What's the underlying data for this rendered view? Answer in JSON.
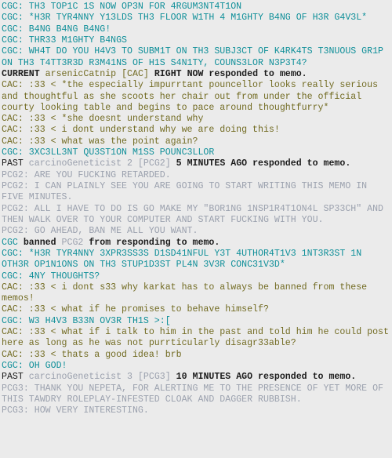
{
  "app": {
    "name": "pesterchum-memo",
    "window_title": "Memo Log"
  },
  "palette": {
    "background": "#ebebeb",
    "cgc_teal": "#0f8f99",
    "cac_olive": "#726b22",
    "pcg_grey_blue": "#9ba1ae",
    "system_black": "#1c1c1c"
  },
  "handles": [
    {
      "id": "CGC",
      "color_key": "cgc_teal"
    },
    {
      "id": "CAC",
      "color_key": "cac_olive",
      "full_name": "arsenicCatnip"
    },
    {
      "id": "PCG2",
      "color_key": "pcg_grey_blue",
      "full_name": "carcinoGeneticist 2"
    },
    {
      "id": "PCG3",
      "color_key": "pcg_grey_blue",
      "full_name": "carcinoGeneticist 3"
    }
  ],
  "log": [
    {
      "kind": "msg",
      "style": "c-cgc",
      "text": "CGC: TH3 TOP1C 1S NOW OP3N FOR 4RGUM3NT4T1ON"
    },
    {
      "kind": "msg",
      "style": "c-cgc",
      "text": "CGC: *H3R TYR4NNY Y13LDS TH3 FLOOR W1TH 4 M1GHTY B4NG OF H3R G4V3L*"
    },
    {
      "kind": "msg",
      "style": "c-cgc",
      "text": "CGC: B4NG B4NG B4NG!"
    },
    {
      "kind": "msg",
      "style": "c-cgc",
      "text": "CGC: THR33 M1GHTY B4NGS"
    },
    {
      "kind": "msg",
      "style": "c-cgc",
      "text": "CGC: WH4T DO YOU H4V3 TO SUBM1T ON TH3 SUBJ3CT OF K4RK4TS T3NUOUS GR1P ON TH3 T4TT3R3D R3M41NS OF H1S S4N1TY, COUNS3LOR N3P3T4?"
    },
    {
      "kind": "system",
      "segments": [
        {
          "text": "CURRENT ",
          "style": "c-sys"
        },
        {
          "text": "arsenicCatnip [CAC]",
          "style": "c-cac"
        },
        {
          "text": " RIGHT NOW responded to memo.",
          "style": "c-sys"
        }
      ]
    },
    {
      "kind": "msg",
      "style": "c-cac",
      "text": "CAC: :33 < *the especially impurrtant pouncellor looks really serious and thoughtful as she scoots her chair out from under the official courty looking table and begins to pace around thoughtfurry*"
    },
    {
      "kind": "msg",
      "style": "c-cac",
      "text": "CAC: :33 < *she doesnt understand why"
    },
    {
      "kind": "msg",
      "style": "c-cac",
      "text": "CAC: :33 < i dont understand why we are doing this!"
    },
    {
      "kind": "msg",
      "style": "c-cac",
      "text": "CAC: :33 < what was the point again?"
    },
    {
      "kind": "msg",
      "style": "c-cgc",
      "text": "CGC: 3XC3LL3NT QU3ST1ON M1SS POUNC3LLOR"
    },
    {
      "kind": "system",
      "segments": [
        {
          "text": "PAST ",
          "style": "c-sys seg-plain"
        },
        {
          "text": "carcinoGeneticist 2 [PCG2]",
          "style": "c-pcg"
        },
        {
          "text": " 5 MINUTES AGO responded to memo.",
          "style": "c-sys"
        }
      ]
    },
    {
      "kind": "msg",
      "style": "c-pcg",
      "text": "PCG2: ARE YOU FUCKING RETARDED."
    },
    {
      "kind": "msg",
      "style": "c-pcg",
      "text": "PCG2: I CAN PLAINLY SEE YOU ARE GOING TO START WRITING THIS MEMO IN FIVE MINUTES."
    },
    {
      "kind": "msg",
      "style": "c-pcg",
      "text": "PCG2: ALL I HAVE TO DO IS GO MAKE MY \"BOR1NG 1NSP1R4T1ON4L SP33CH\" AND THEN WALK OVER TO YOUR COMPUTER AND START FUCKING WITH YOU."
    },
    {
      "kind": "msg",
      "style": "c-pcg",
      "text": "PCG2: GO AHEAD, BAN ME ALL YOU WANT."
    },
    {
      "kind": "system",
      "segments": [
        {
          "text": "CGC",
          "style": "c-cgc"
        },
        {
          "text": " banned ",
          "style": "c-sys"
        },
        {
          "text": "PCG2",
          "style": "c-pcg"
        },
        {
          "text": " from responding to memo.",
          "style": "c-sys"
        }
      ]
    },
    {
      "kind": "msg",
      "style": "c-cgc",
      "text": "CGC: *H3R TYR4NNY 3XPR3SS3S D1SD41NFUL Y3T 4UTHOR4T1V3 1NT3R3ST 1N OTH3R OP1N1ONS ON TH3 STUP1D3ST PL4N 3V3R CONC31V3D*"
    },
    {
      "kind": "msg",
      "style": "c-cgc",
      "text": "CGC: 4NY THOUGHTS?"
    },
    {
      "kind": "msg",
      "style": "c-cac",
      "text": "CAC: :33 < i dont s33 why karkat has to always be banned from these memos!"
    },
    {
      "kind": "msg",
      "style": "c-cac",
      "text": "CAC: :33 < what if he promises to behave himself?"
    },
    {
      "kind": "msg",
      "style": "c-cgc",
      "text": "CGC: W3 H4V3 B33N OV3R TH1S >:["
    },
    {
      "kind": "msg",
      "style": "c-cac",
      "text": "CAC: :33 < what if i talk to him in the past and told him he could post here as long as he was not purrticularly disagr33able?"
    },
    {
      "kind": "msg",
      "style": "c-cac",
      "text": "CAC: :33 < thats a good idea! brb"
    },
    {
      "kind": "msg",
      "style": "c-cgc",
      "text": "CGC: OH GOD!"
    },
    {
      "kind": "system",
      "segments": [
        {
          "text": "PAST ",
          "style": "c-sys seg-plain"
        },
        {
          "text": "carcinoGeneticist 3 [PCG3]",
          "style": "c-pcg"
        },
        {
          "text": " 10 MINUTES AGO responded to memo.",
          "style": "c-sys"
        }
      ]
    },
    {
      "kind": "msg",
      "style": "c-pcg",
      "text": "PCG3: THANK YOU NEPETA, FOR ALERTING ME TO THE PRESENCE OF YET MORE OF THIS TAWDRY ROLEPLAY-INFESTED CLOAK AND DAGGER RUBBISH."
    },
    {
      "kind": "msg",
      "style": "c-pcg",
      "text": "PCG3: HOW VERY INTERESTING."
    }
  ]
}
